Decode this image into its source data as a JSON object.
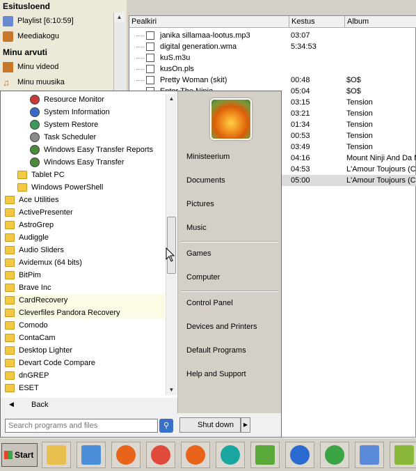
{
  "left_panel": {
    "heading_playlists": "Esitusloend",
    "playlist_item": "Playlist [6:10:59]",
    "media_library": "Meediakogu",
    "heading_my": "Minu arvuti",
    "my_videos": "Minu videod",
    "my_music": "Minu muusika"
  },
  "playlist": {
    "columns": [
      "Pealkiri",
      "Kestus",
      "Album"
    ],
    "rows": [
      {
        "title": "janika sillamaa-lootus.mp3",
        "duration": "03:07",
        "album": ""
      },
      {
        "title": "digital generation.wma",
        "duration": "5:34:53",
        "album": ""
      },
      {
        "title": "kuS.m3u",
        "duration": "",
        "album": ""
      },
      {
        "title": "kusOn.pls",
        "duration": "",
        "album": ""
      },
      {
        "title": "Pretty Woman (skit)",
        "duration": "00:48",
        "album": "$O$"
      },
      {
        "title": "Enter The Ninja",
        "duration": "05:04",
        "album": "$O$"
      },
      {
        "title": "",
        "duration": "03:15",
        "album": "Tension"
      },
      {
        "title": "",
        "duration": "03:21",
        "album": "Tension"
      },
      {
        "title": "",
        "duration": "01:34",
        "album": "Tension"
      },
      {
        "title": "",
        "duration": "00:53",
        "album": "Tension"
      },
      {
        "title": "",
        "duration": "03:49",
        "album": "Tension"
      },
      {
        "title": "",
        "duration": "04:16",
        "album": "Mount Ninji And Da N"
      },
      {
        "title": "",
        "duration": "04:53",
        "album": "L'Amour Toujours (CD"
      },
      {
        "title": "",
        "duration": "05:00",
        "album": "L'Amour Toujours (CD"
      }
    ],
    "selected_row": 13
  },
  "start_menu": {
    "programs": [
      {
        "label": "Resource Monitor",
        "icon": "resource-monitor-icon",
        "indent": 2
      },
      {
        "label": "System Information",
        "icon": "system-information-icon",
        "indent": 2
      },
      {
        "label": "System Restore",
        "icon": "system-restore-icon",
        "indent": 2
      },
      {
        "label": "Task Scheduler",
        "icon": "task-scheduler-icon",
        "indent": 2
      },
      {
        "label": "Windows Easy Transfer Reports",
        "icon": "easy-transfer-icon",
        "indent": 2
      },
      {
        "label": "Windows Easy Transfer",
        "icon": "easy-transfer-icon",
        "indent": 2
      },
      {
        "label": "Tablet PC",
        "icon": "folder-icon",
        "indent": 1
      },
      {
        "label": "Windows PowerShell",
        "icon": "folder-icon",
        "indent": 1
      },
      {
        "label": "Ace Utilities",
        "icon": "folder-icon",
        "indent": 0
      },
      {
        "label": "ActivePresenter",
        "icon": "folder-icon",
        "indent": 0
      },
      {
        "label": "AstroGrep",
        "icon": "folder-icon",
        "indent": 0
      },
      {
        "label": "Audiggle",
        "icon": "folder-icon",
        "indent": 0
      },
      {
        "label": "Audio Sliders",
        "icon": "folder-icon",
        "indent": 0
      },
      {
        "label": "Avidemux (64 bits)",
        "icon": "folder-icon",
        "indent": 0
      },
      {
        "label": "BitPim",
        "icon": "folder-icon",
        "indent": 0
      },
      {
        "label": "Brave Inc",
        "icon": "folder-icon",
        "indent": 0
      },
      {
        "label": "CardRecovery",
        "icon": "folder-icon",
        "indent": 0,
        "highlight": true
      },
      {
        "label": "Cleverfiles Pandora Recovery",
        "icon": "folder-icon",
        "indent": 0,
        "highlight": true
      },
      {
        "label": "Comodo",
        "icon": "folder-icon",
        "indent": 0
      },
      {
        "label": "ContaCam",
        "icon": "folder-icon",
        "indent": 0
      },
      {
        "label": "Desktop Lighter",
        "icon": "folder-icon",
        "indent": 0
      },
      {
        "label": "Devart Code Compare",
        "icon": "folder-icon",
        "indent": 0
      },
      {
        "label": "dnGREP",
        "icon": "folder-icon",
        "indent": 0
      },
      {
        "label": "ESET",
        "icon": "folder-icon",
        "indent": 0
      }
    ],
    "back_label": "Back",
    "search_placeholder": "Search programs and files",
    "right_items": [
      {
        "label": "Ministeerium",
        "group": 0
      },
      {
        "label": "Documents",
        "group": 0
      },
      {
        "label": "Pictures",
        "group": 0
      },
      {
        "label": "Music",
        "group": 0
      },
      {
        "label": "Games",
        "group": 1
      },
      {
        "label": "Computer",
        "group": 1
      },
      {
        "label": "Control Panel",
        "group": 2
      },
      {
        "label": "Devices and Printers",
        "group": 2
      },
      {
        "label": "Default Programs",
        "group": 2
      },
      {
        "label": "Help and Support",
        "group": 2
      }
    ],
    "shutdown_label": "Shut down"
  },
  "taskbar": {
    "start_label": "Start",
    "apps": [
      {
        "icon": "file-manager-icon",
        "color": "#e8c050"
      },
      {
        "icon": "media-player-icon",
        "color": "#4a8fd8"
      },
      {
        "icon": "firefox-icon",
        "color": "#e8641a"
      },
      {
        "icon": "opera-like-icon",
        "color": "#e04a3a"
      },
      {
        "icon": "firefox-icon",
        "color": "#e8641a"
      },
      {
        "icon": "eset-icon",
        "color": "#1aa6a0"
      },
      {
        "icon": "install-icon",
        "color": "#5aa83a"
      },
      {
        "icon": "browser-globe-icon",
        "color": "#2a6ad0"
      },
      {
        "icon": "windows-logo-icon",
        "color": "#3ba445"
      },
      {
        "icon": "control-panel-icon",
        "color": "#5a8ad8"
      },
      {
        "icon": "notepad-plus-icon",
        "color": "#8ab83a"
      }
    ]
  }
}
